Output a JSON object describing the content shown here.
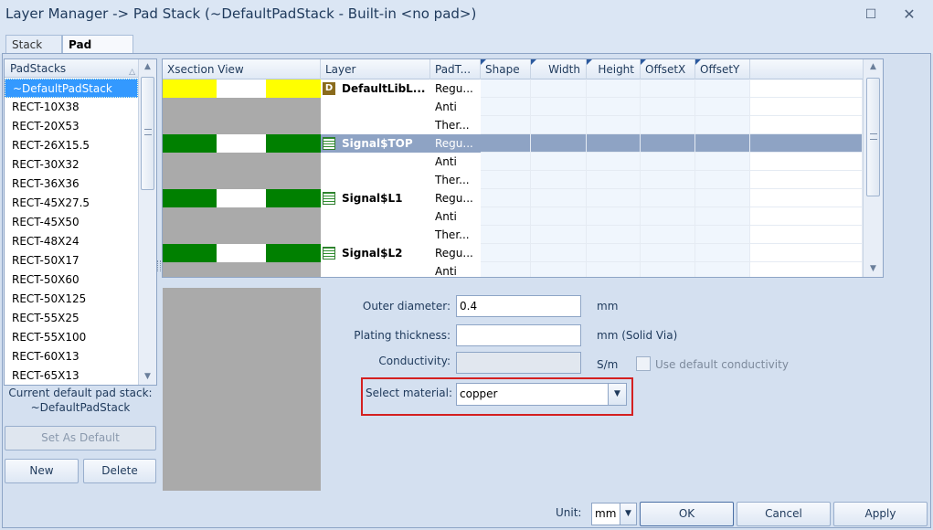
{
  "window": {
    "title": "Layer Manager -> Pad Stack (~DefaultPadStack - Built-in <no pad>)"
  },
  "tabs": [
    {
      "label": "Stack Up"
    },
    {
      "label": "Pad Stack"
    }
  ],
  "padstacks": {
    "header": "PadStacks",
    "items": [
      "~DefaultPadStack",
      "RECT-10X38",
      "RECT-20X53",
      "RECT-26X15.5",
      "RECT-30X32",
      "RECT-36X36",
      "RECT-45X27.5",
      "RECT-45X50",
      "RECT-48X24",
      "RECT-50X17",
      "RECT-50X60",
      "RECT-50X125",
      "RECT-55X25",
      "RECT-55X100",
      "RECT-60X13",
      "RECT-65X13"
    ],
    "selected_index": 0,
    "current_default_label": "Current default pad stack:",
    "current_default_value": "~DefaultPadStack",
    "set_default_button": "Set As Default",
    "new_button": "New",
    "delete_button": "Delete"
  },
  "grid": {
    "columns": [
      "Xsection View",
      "Layer",
      "PadT...",
      "Shape",
      "Width",
      "Height",
      "OffsetX",
      "OffsetY"
    ],
    "rows": [
      {
        "layer": "DefaultLibL...",
        "pad": "Regu...",
        "xs": "yellow",
        "icon": "D"
      },
      {
        "layer": "",
        "pad": "Anti",
        "xs": "gray"
      },
      {
        "layer": "",
        "pad": "Ther...",
        "xs": "gray"
      },
      {
        "layer": "Signal$TOP",
        "pad": "Regu...",
        "xs": "green",
        "icon": "signal",
        "selected": true
      },
      {
        "layer": "",
        "pad": "Anti",
        "xs": "gray"
      },
      {
        "layer": "",
        "pad": "Ther...",
        "xs": "gray"
      },
      {
        "layer": "Signal$L1",
        "pad": "Regu...",
        "xs": "green",
        "icon": "signal"
      },
      {
        "layer": "",
        "pad": "Anti",
        "xs": "gray"
      },
      {
        "layer": "",
        "pad": "Ther...",
        "xs": "gray"
      },
      {
        "layer": "Signal$L2",
        "pad": "Regu...",
        "xs": "green",
        "icon": "signal"
      },
      {
        "layer": "",
        "pad": "Anti",
        "xs": "gray"
      }
    ]
  },
  "props": {
    "outer_diameter_label": "Outer diameter:",
    "outer_diameter_value": "0.4",
    "outer_diameter_unit": "mm",
    "plating_label": "Plating thickness:",
    "plating_value": "",
    "plating_unit": "mm (Solid Via)",
    "conductivity_label": "Conductivity:",
    "conductivity_value": "",
    "conductivity_unit": "S/m",
    "use_default_label": "Use default conductivity",
    "use_default_checked": false,
    "material_label": "Select material:",
    "material_value": "copper"
  },
  "footer": {
    "unit_label": "Unit:",
    "unit_value": "mm",
    "ok": "OK",
    "cancel": "Cancel",
    "apply": "Apply"
  },
  "colors": {
    "yellow": "#ffff00",
    "green": "#008000",
    "gray": "#aaaaaa",
    "selected_row": "#8ea3c4",
    "accent": "#3399ff",
    "highlight_box": "#d42020"
  }
}
